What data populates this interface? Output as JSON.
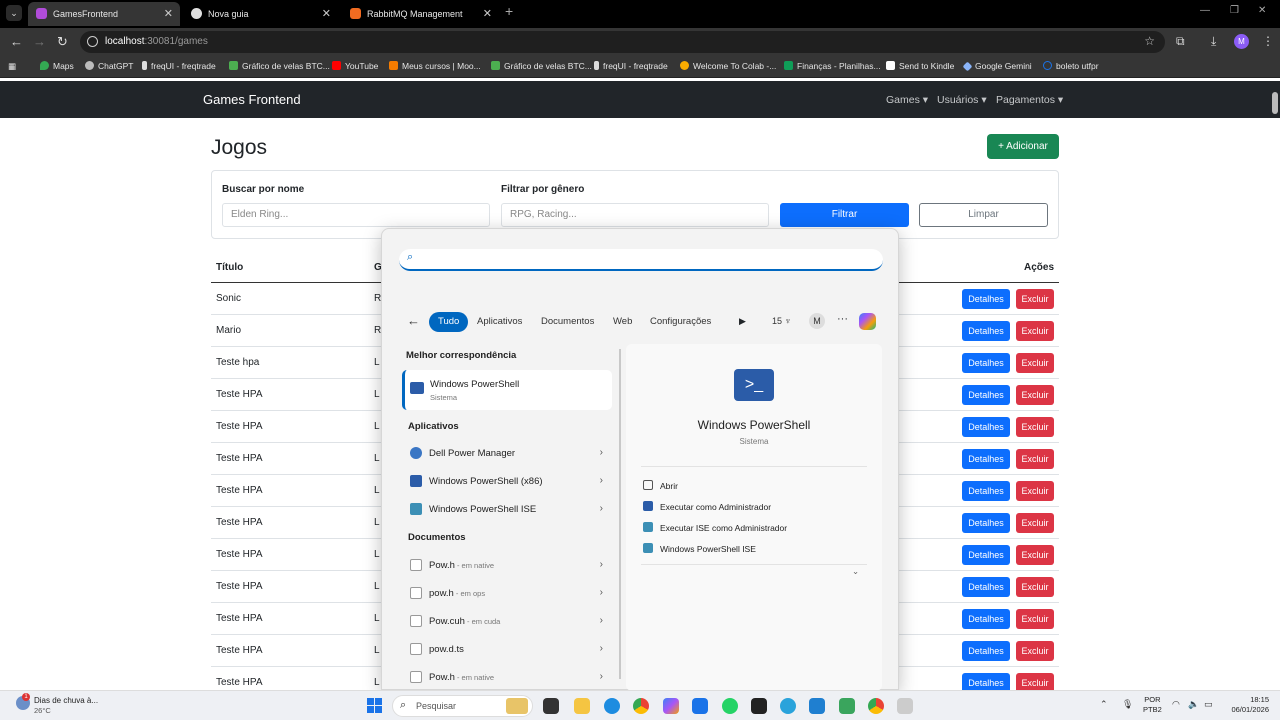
{
  "browser": {
    "tabs": [
      {
        "title": "GamesFrontend",
        "active": true,
        "color": "#b04cd9"
      },
      {
        "title": "Nova guia",
        "active": false,
        "color": "#e0e0e0"
      },
      {
        "title": "RabbitMQ Management",
        "active": false,
        "color": "#f06b21"
      }
    ],
    "url_host": "localhost",
    "url_path": ":30081/games",
    "bookmarks": [
      {
        "label": "Maps",
        "color": "#34a853"
      },
      {
        "label": "ChatGPT",
        "color": "#bbbbbb"
      },
      {
        "label": "freqUI - freqtrade",
        "color": "#dddddd"
      },
      {
        "label": "Gráfico de velas BTC...",
        "color": "#4caf50"
      },
      {
        "label": "YouTube",
        "color": "#ff0000"
      },
      {
        "label": "Meus cursos | Moo...",
        "color": "#f57c00"
      },
      {
        "label": "Gráfico de velas BTC...",
        "color": "#4caf50"
      },
      {
        "label": "freqUI - freqtrade",
        "color": "#dddddd"
      },
      {
        "label": "Welcome To Colab -...",
        "color": "#f9ab00"
      },
      {
        "label": "Finanças - Planilhas...",
        "color": "#0f9d58"
      },
      {
        "label": "Send to Kindle",
        "color": "#ffffff"
      },
      {
        "label": "Google Gemini",
        "color": "#8ab4f8"
      },
      {
        "label": "boleto utfpr",
        "color": "#1a73e8"
      }
    ],
    "avatar": "M"
  },
  "app": {
    "brand": "Games Frontend",
    "nav": [
      "Games",
      "Usuários",
      "Pagamentos"
    ],
    "page_title": "Jogos",
    "add_button": "+ Adicionar",
    "filter": {
      "name_label": "Buscar por nome",
      "name_placeholder": "Elden Ring...",
      "genre_label": "Filtrar por gênero",
      "genre_placeholder": "RPG, Racing...",
      "filter_button": "Filtrar",
      "clear_button": "Limpar"
    },
    "table": {
      "headers": [
        "Título",
        "G",
        "Ações"
      ],
      "rows": [
        {
          "title": "Sonic",
          "genre": "R"
        },
        {
          "title": "Mario",
          "genre": "R"
        },
        {
          "title": "Teste hpa",
          "genre": "L"
        },
        {
          "title": "Teste HPA",
          "genre": "L"
        },
        {
          "title": "Teste HPA",
          "genre": "L"
        },
        {
          "title": "Teste HPA",
          "genre": "L"
        },
        {
          "title": "Teste HPA",
          "genre": "L"
        },
        {
          "title": "Teste HPA",
          "genre": "L"
        },
        {
          "title": "Teste HPA",
          "genre": "L"
        },
        {
          "title": "Teste HPA",
          "genre": "L"
        },
        {
          "title": "Teste HPA",
          "genre": "L"
        },
        {
          "title": "Teste HPA",
          "genre": "L"
        },
        {
          "title": "Teste HPA",
          "genre": "L"
        }
      ],
      "details_label": "Detalhes",
      "delete_label": "Excluir"
    }
  },
  "start_search": {
    "filters": [
      "Tudo",
      "Aplicativos",
      "Documentos",
      "Web",
      "Configurações"
    ],
    "points": "15",
    "avatar": "M",
    "best_match_header": "Melhor correspondência",
    "best_match": {
      "name": "Windows PowerShell",
      "sub": "Sistema"
    },
    "apps_header": "Aplicativos",
    "apps": [
      "Dell Power Manager",
      "Windows PowerShell (x86)",
      "Windows PowerShell ISE"
    ],
    "docs_header": "Documentos",
    "docs": [
      {
        "name": "Pow.h",
        "loc": " - em native"
      },
      {
        "name": "pow.h",
        "loc": " - em ops"
      },
      {
        "name": "Pow.cuh",
        "loc": " - em cuda"
      },
      {
        "name": "pow.d.ts",
        "loc": ""
      },
      {
        "name": "Pow.h",
        "loc": " - em native"
      }
    ],
    "detail": {
      "name": "Windows PowerShell",
      "sub": "Sistema",
      "actions": [
        "Abrir",
        "Executar como Administrador",
        "Executar ISE como Administrador",
        "Windows PowerShell ISE"
      ]
    }
  },
  "taskbar": {
    "weather_title": "Dias de chuva à...",
    "weather_temp": "26°C",
    "weather_badge": "1",
    "search_placeholder": "Pesquisar",
    "lang_1": "POR",
    "lang_2": "PTB2",
    "time": "18:15",
    "date": "06/01/2026"
  }
}
